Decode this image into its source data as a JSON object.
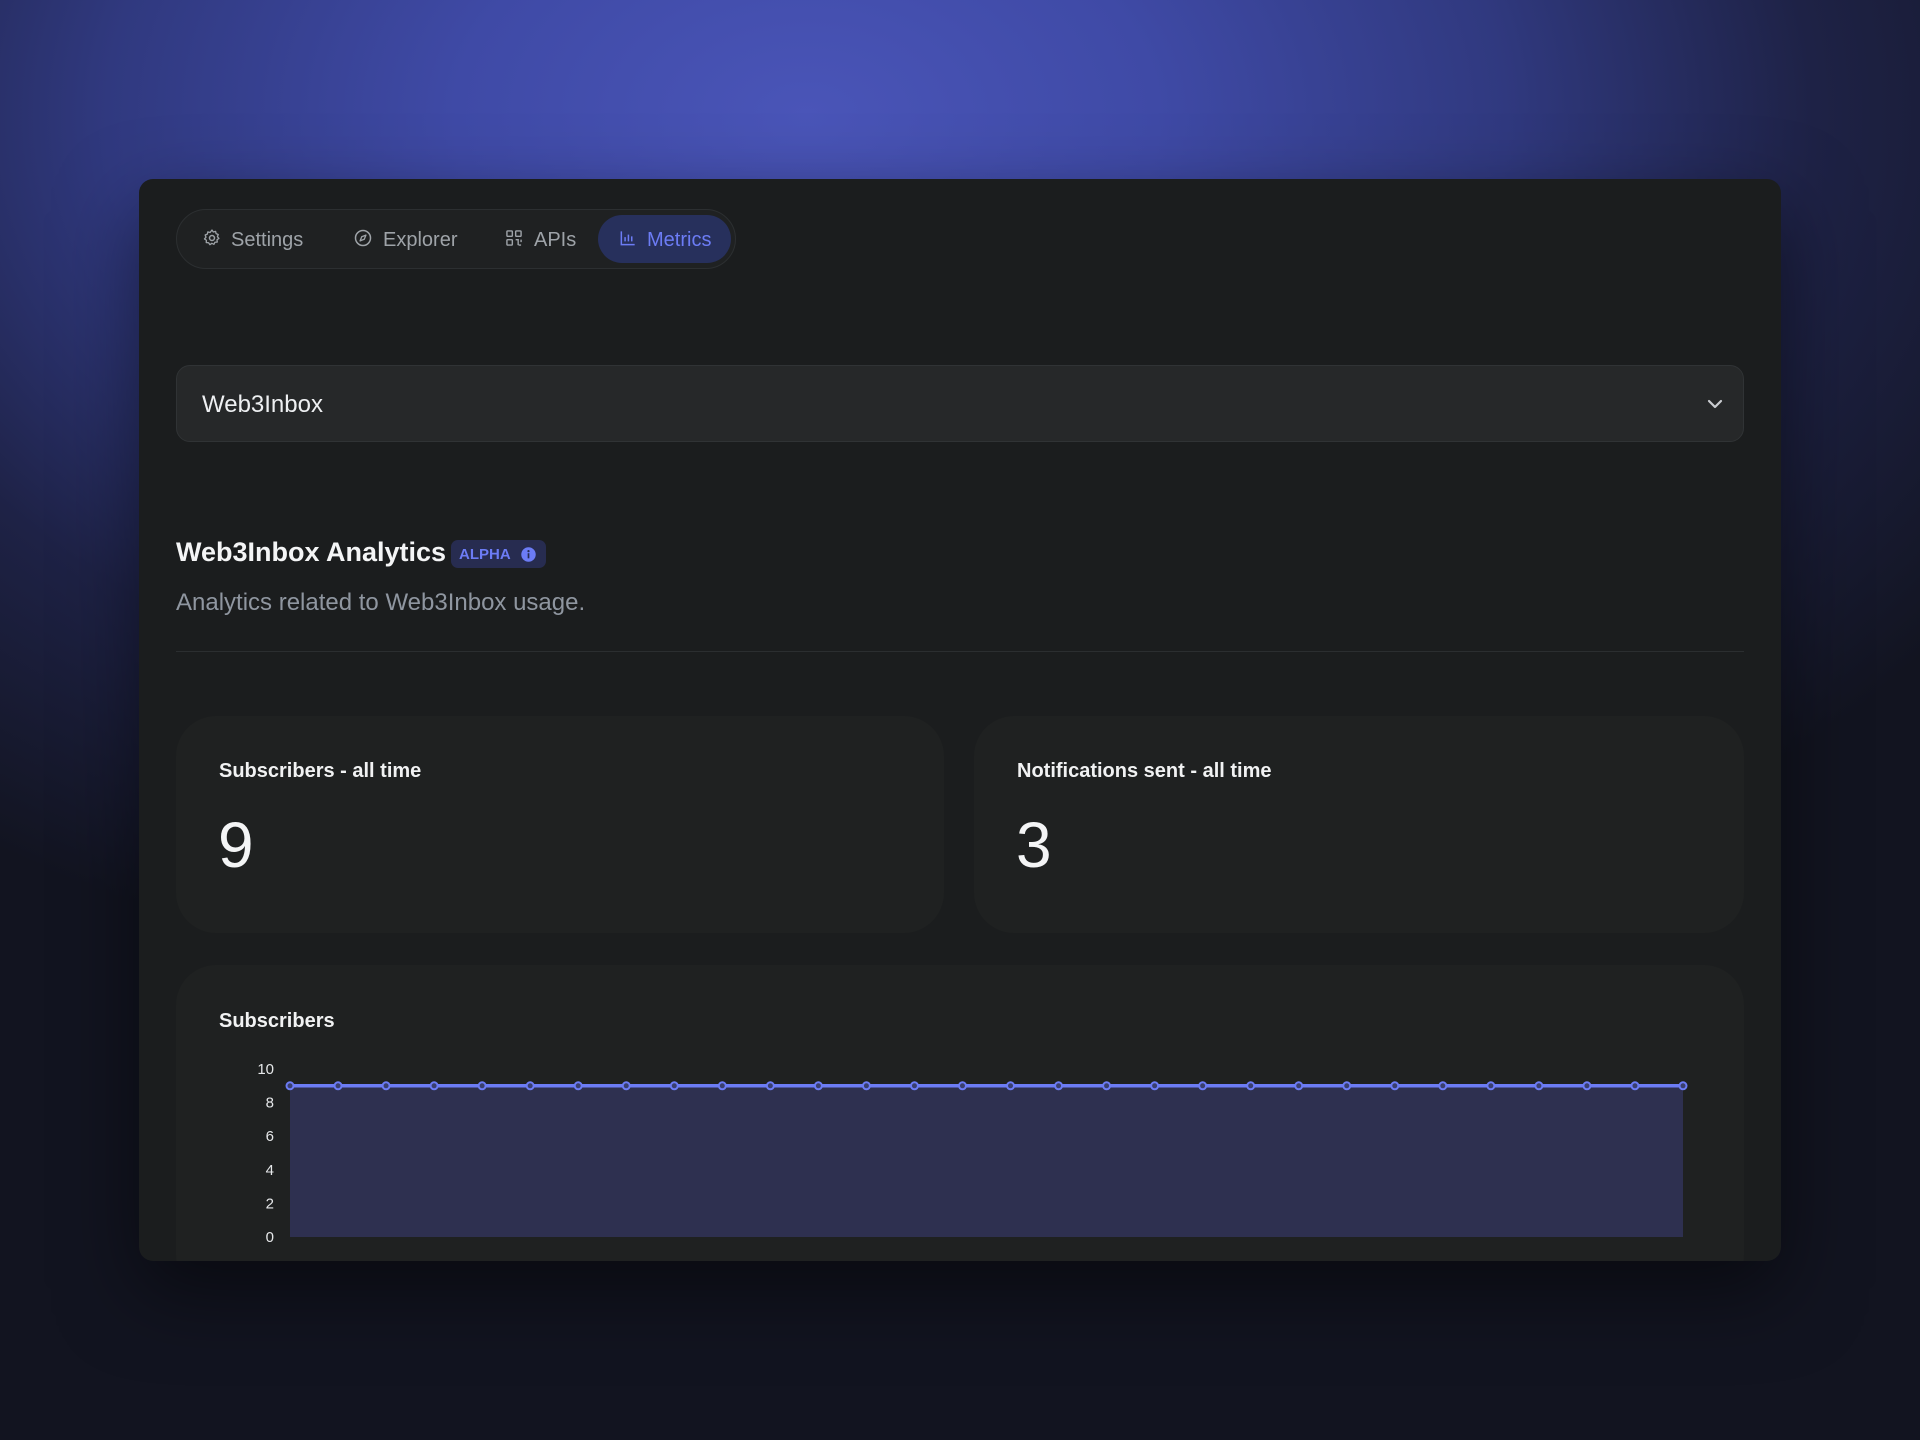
{
  "tabs": [
    {
      "label": "Settings",
      "icon": "gear-icon",
      "active": false
    },
    {
      "label": "Explorer",
      "icon": "compass-icon",
      "active": false
    },
    {
      "label": "APIs",
      "icon": "api-icon",
      "active": false
    },
    {
      "label": "Metrics",
      "icon": "bar-chart-icon",
      "active": true
    }
  ],
  "project_select": {
    "value": "Web3Inbox",
    "icon": "chevron-down-icon"
  },
  "section": {
    "title": "Web3Inbox Analytics",
    "badge": "ALPHA",
    "subtitle": "Analytics related to Web3Inbox usage."
  },
  "stats": [
    {
      "label": "Subscribers - all time",
      "value": "9"
    },
    {
      "label": "Notifications sent - all time",
      "value": "3"
    }
  ],
  "colors": {
    "accent": "#6c7cf5",
    "panel": "#1b1d1e",
    "card": "#1f2121",
    "area_fill": "#2e3050"
  },
  "chart_data": {
    "type": "area",
    "title": "Subscribers",
    "y_ticks": [
      "10",
      "8",
      "6",
      "4",
      "2",
      "0"
    ],
    "ylim": [
      0,
      10
    ],
    "series": [
      {
        "values": [
          9,
          9,
          9,
          9,
          9,
          9,
          9,
          9,
          9,
          9,
          9,
          9,
          9,
          9,
          9,
          9,
          9,
          9,
          9,
          9,
          9,
          9,
          9,
          9,
          9,
          9,
          9,
          9,
          9,
          9
        ]
      }
    ],
    "grid": false
  }
}
